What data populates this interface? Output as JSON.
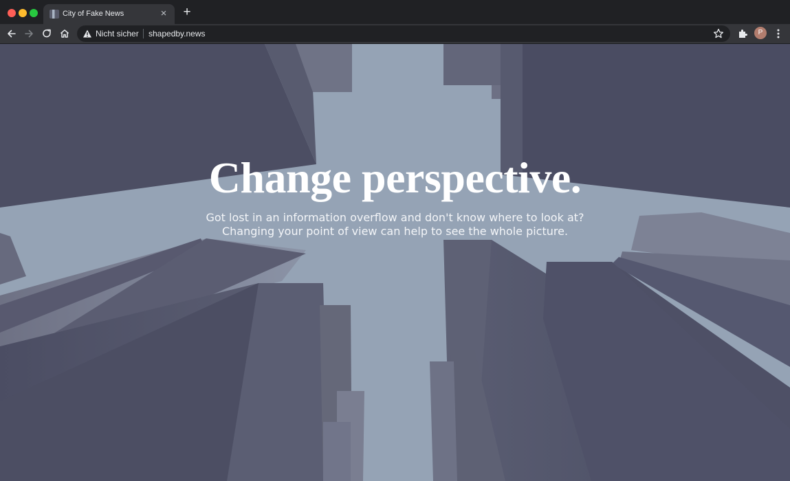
{
  "browser": {
    "tab": {
      "title": "City of Fake News",
      "favicon": "city-favicon-icon"
    },
    "new_tab_icon": "plus-icon",
    "toolbar": {
      "security_label": "Nicht sicher",
      "url": "shapedby.news",
      "profile_initial": "P"
    }
  },
  "page": {
    "headline": "Change perspective.",
    "subline_1": "Got lost in an information overflow and don't know where to look at?",
    "subline_2": "Changing your point of view can help to see the whole picture."
  },
  "colors": {
    "sky": "#95a3b5",
    "buildings": "#4d4f66",
    "chrome_dark": "#202124",
    "chrome_toolbar": "#35363a"
  }
}
